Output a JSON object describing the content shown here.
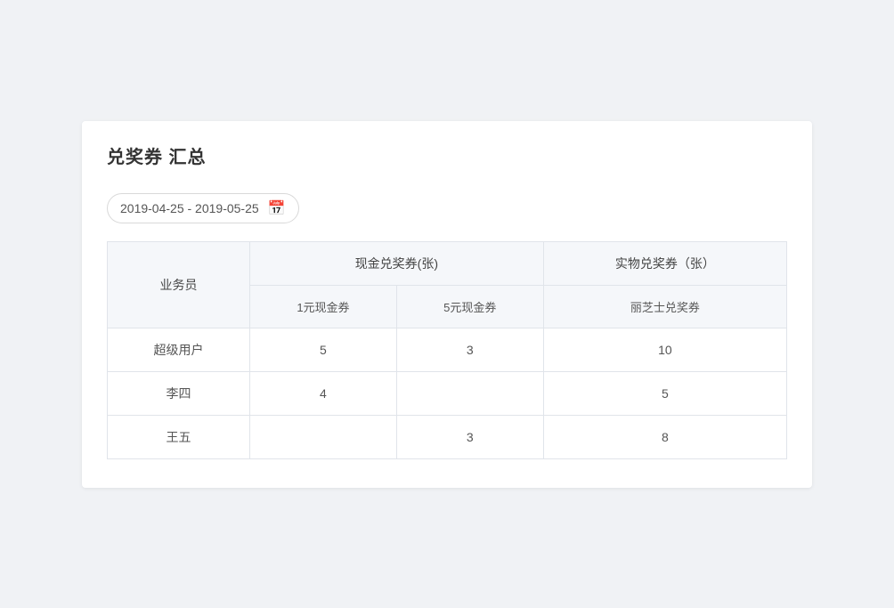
{
  "page": {
    "title": "兑奖券 汇总",
    "date_range": "2019-04-25 - 2019-05-25",
    "date_placeholder": "2019-04-25 - 2019-05-25"
  },
  "table": {
    "col_agent": "业务员",
    "col_cash_group": "现金兑奖券(张)",
    "col_physical_group": "实物兑奖券（张）",
    "col_1yuan": "1元现金券",
    "col_5yuan": "5元现金券",
    "col_lizhi": "丽芝士兑奖券",
    "rows": [
      {
        "agent": "超级用户",
        "yuan1": "5",
        "yuan5": "3",
        "lizhi": "10"
      },
      {
        "agent": "李四",
        "yuan1": "4",
        "yuan5": "",
        "lizhi": "5"
      },
      {
        "agent": "王五",
        "yuan1": "",
        "yuan5": "3",
        "lizhi": "8"
      }
    ]
  },
  "icons": {
    "calendar": "📅"
  }
}
